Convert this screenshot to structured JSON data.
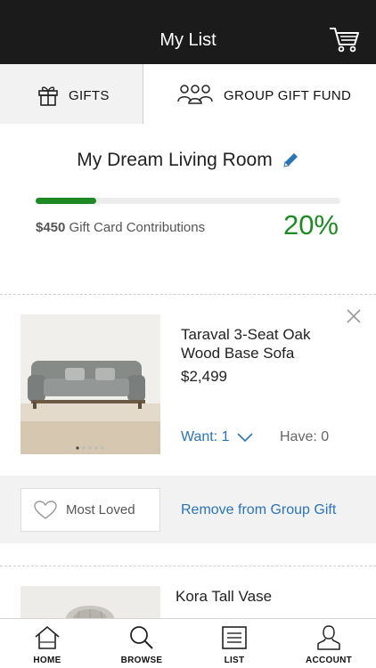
{
  "header": {
    "title": "My List",
    "cart_icon": "cart-icon"
  },
  "tabs": [
    {
      "label": "GIFTS",
      "icon": "gift-icon",
      "active": true
    },
    {
      "label": "GROUP GIFT FUND",
      "icon": "group-icon",
      "active": false
    }
  ],
  "list": {
    "title": "My Dream Living Room",
    "edit_icon": "pencil-icon"
  },
  "progress": {
    "fraction": 0.2,
    "amount": "$450",
    "label": "Gift Card Contributions",
    "percent_text": "20%",
    "color": "#1f8a24"
  },
  "items": [
    {
      "name": "Taraval 3-Seat Oak Wood Base Sofa",
      "price": "$2,499",
      "want_label": "Want: 1",
      "have_label": "Have: 0",
      "image_icon": "sofa-image"
    },
    {
      "name": "Kora Tall Vase",
      "image_icon": "vase-image"
    }
  ],
  "actions": {
    "most_loved": "Most Loved",
    "remove": "Remove from Group Gift"
  },
  "nav": [
    {
      "label": "HOME",
      "icon": "home-icon"
    },
    {
      "label": "BROWSE",
      "icon": "search-icon"
    },
    {
      "label": "LIST",
      "icon": "list-icon"
    },
    {
      "label": "ACCOUNT",
      "icon": "account-icon"
    }
  ],
  "colors": {
    "accent": "#2a74b8",
    "progress": "#1f8a24",
    "header": "#1b1b1b"
  }
}
